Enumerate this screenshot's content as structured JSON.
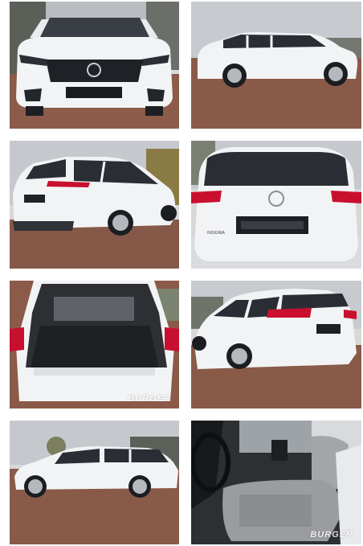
{
  "gallery": {
    "photos": [
      {
        "label": "front-view"
      },
      {
        "label": "side-front-view"
      },
      {
        "label": "rear-three-quarter-view"
      },
      {
        "label": "rear-view",
        "badge": "INSIGNIA"
      },
      {
        "label": "open-trunk-view",
        "watermark": "BURGER"
      },
      {
        "label": "rear-three-quarter-right-view"
      },
      {
        "label": "side-profile-view"
      },
      {
        "label": "interior-seats-view",
        "watermark": "BURGER"
      }
    ]
  },
  "colors": {
    "car_body": "#f2f3f5",
    "window_tint": "#2a2e34",
    "paving": "#8a5a48",
    "sky": "#c9cdd2",
    "light_red": "#c8102e",
    "seat_grey": "#9a9c9f"
  }
}
